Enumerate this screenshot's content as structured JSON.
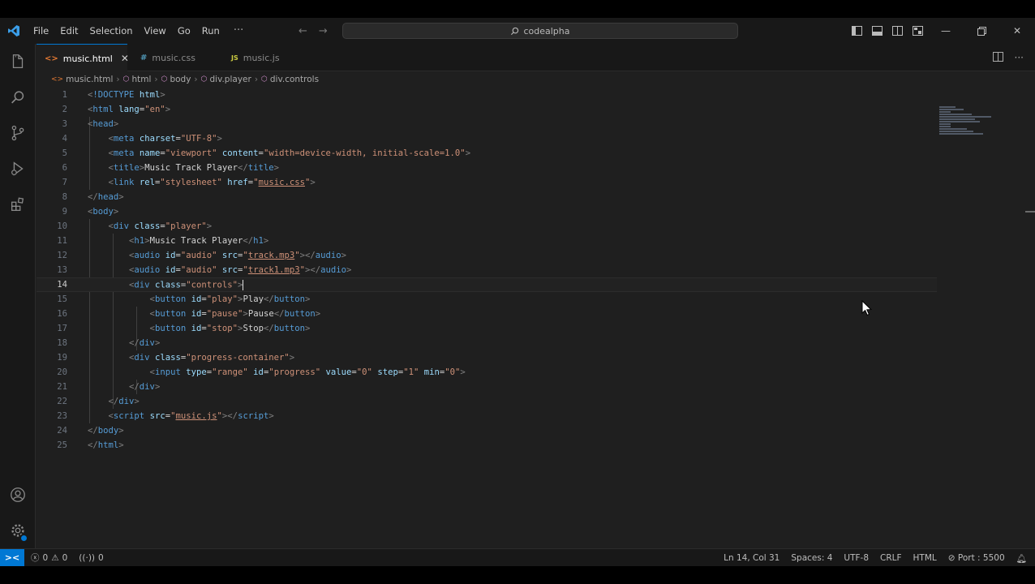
{
  "titlebar": {
    "menu": [
      "File",
      "Edit",
      "Selection",
      "View",
      "Go",
      "Run"
    ],
    "more": "···",
    "search_text": "codealpha"
  },
  "tabs": [
    {
      "label": "music.html",
      "icon": "<>",
      "icon_color": "#e37933",
      "active": true,
      "close": "✕"
    },
    {
      "label": "music.css",
      "icon": "#",
      "icon_color": "#519aba",
      "active": false
    },
    {
      "label": "music.js",
      "icon": "JS",
      "icon_color": "#cbcb41",
      "active": false
    }
  ],
  "breadcrumb": [
    "music.html",
    "html",
    "body",
    "div.player",
    "div.controls"
  ],
  "editor": {
    "line_numbers": [
      "1",
      "2",
      "3",
      "4",
      "5",
      "6",
      "7",
      "8",
      "9",
      "10",
      "11",
      "12",
      "13",
      "14",
      "15",
      "16",
      "17",
      "18",
      "19",
      "20",
      "21",
      "22",
      "23",
      "24",
      "25"
    ],
    "current_line": 14,
    "code": {
      "l1": {
        "doctype": "!DOCTYPE",
        "html": "html"
      },
      "l2": {
        "tag": "html",
        "attr": "lang",
        "val": "\"en\""
      },
      "l3": {
        "tag": "head"
      },
      "l4": {
        "tag": "meta",
        "attr": "charset",
        "val": "\"UTF-8\""
      },
      "l5": {
        "tag": "meta",
        "a1": "name",
        "v1": "\"viewport\"",
        "a2": "content",
        "v2": "\"width=device-width, initial-scale=1.0\""
      },
      "l6": {
        "tag": "title",
        "text": "Music Track Player"
      },
      "l7": {
        "tag": "link",
        "a1": "rel",
        "v1": "\"stylesheet\"",
        "a2": "href",
        "v2q1": "\"",
        "v2": "music.css",
        "v2q2": "\""
      },
      "l8": {
        "tag": "head"
      },
      "l9": {
        "tag": "body"
      },
      "l10": {
        "tag": "div",
        "attr": "class",
        "val": "\"player\""
      },
      "l11": {
        "tag": "h1",
        "text": "Music Track Player"
      },
      "l12": {
        "tag": "audio",
        "a1": "id",
        "v1": "\"audio\"",
        "a2": "src",
        "q1": "\"",
        "file": "track.mp3",
        "q2": "\""
      },
      "l13": {
        "tag": "audio",
        "a1": "id",
        "v1": "\"audio\"",
        "a2": "src",
        "q1": "\"",
        "file": "track1.mp3",
        "q2": "\""
      },
      "l14": {
        "tag": "div",
        "attr": "class",
        "val": "\"controls\""
      },
      "l15": {
        "tag": "button",
        "attr": "id",
        "val": "\"play\"",
        "text": "Play"
      },
      "l16": {
        "tag": "button",
        "attr": "id",
        "val": "\"pause\"",
        "text": "Pause"
      },
      "l17": {
        "tag": "button",
        "attr": "id",
        "val": "\"stop\"",
        "text": "Stop"
      },
      "l18": {
        "tag": "div"
      },
      "l19": {
        "tag": "div",
        "attr": "class",
        "val": "\"progress-container\""
      },
      "l20": {
        "tag": "input",
        "a1": "type",
        "v1": "\"range\"",
        "a2": "id",
        "v2": "\"progress\"",
        "a3": "value",
        "v3": "\"0\"",
        "a4": "step",
        "v4": "\"1\"",
        "a5": "min",
        "v5": "\"0\""
      },
      "l21": {
        "tag": "div"
      },
      "l22": {
        "tag": "div"
      },
      "l23": {
        "tag": "script",
        "attr": "src",
        "q1": "\"",
        "file": "music.js",
        "q2": "\"",
        "close_tag": "script"
      },
      "l24": {
        "tag": "body"
      },
      "l25": {
        "tag": "html"
      }
    }
  },
  "statusbar": {
    "errors": "0",
    "warnings": "0",
    "ports": "0",
    "position": "Ln 14, Col 31",
    "spaces": "Spaces: 4",
    "encoding": "UTF-8",
    "eol": "CRLF",
    "language": "HTML",
    "port": "Port : 5500"
  },
  "colors": {
    "accent": "#0078d4",
    "tag": "#569cd6",
    "attribute": "#9cdcfe",
    "string": "#ce9178"
  }
}
